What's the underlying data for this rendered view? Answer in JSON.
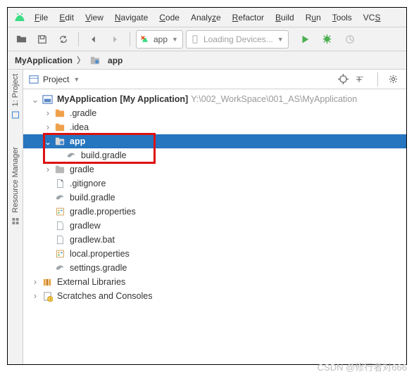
{
  "menus": {
    "file": "File",
    "edit": "Edit",
    "view": "View",
    "navigate": "Navigate",
    "code": "Code",
    "analyze": "Analyze",
    "refactor": "Refactor",
    "build": "Build",
    "run": "Run",
    "tools": "Tools",
    "vcs": "VCS"
  },
  "toolbar": {
    "config_label": "app",
    "device_label": "Loading Devices..."
  },
  "breadcrumbs": {
    "root": "MyApplication",
    "current": "app"
  },
  "sidebar": {
    "project_label": "1: Project",
    "resource_label": "Resource Manager"
  },
  "panel": {
    "title": "Project"
  },
  "tree": {
    "root_name": "MyApplication",
    "root_desc": "[My Application]",
    "root_path": "Y:\\002_WorkSpace\\001_AS\\MyApplication",
    "gradle_dir": ".gradle",
    "idea_dir": ".idea",
    "app_dir": "app",
    "app_build_gradle": "build.gradle",
    "gradle_dir2": "gradle",
    "gitignore": ".gitignore",
    "build_gradle": "build.gradle",
    "gradle_properties": "gradle.properties",
    "gradlew": "gradlew",
    "gradlew_bat": "gradlew.bat",
    "local_properties": "local.properties",
    "settings_gradle": "settings.gradle",
    "ext_libs": "External Libraries",
    "scratches": "Scratches and Consoles"
  },
  "watermark": "CSDN @修行者对666"
}
